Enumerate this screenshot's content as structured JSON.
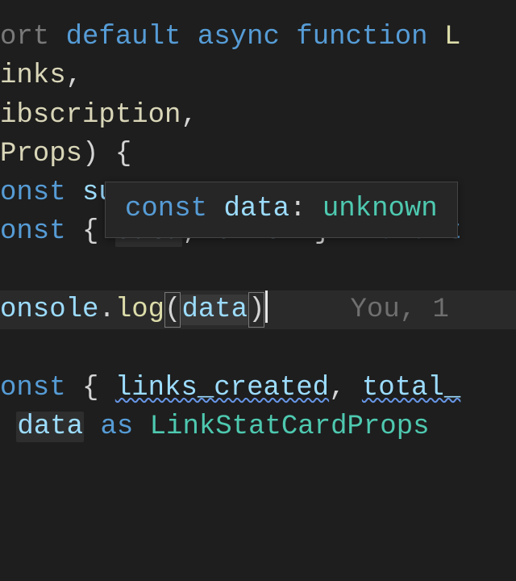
{
  "code": {
    "l1": {
      "pre": "ort ",
      "kw_default": "default",
      "sp1": " ",
      "kw_async": "async",
      "sp2": " ",
      "kw_function": "function",
      "sp3": " ",
      "fn": "L"
    },
    "l2": {
      "pre": "",
      "id": "inks",
      "comma": ","
    },
    "l3": {
      "pre": "",
      "id": "ibscription",
      "comma": ","
    },
    "l4": {
      "pre": "",
      "id": "Props",
      "paren": ")",
      "sp": " ",
      "brace": "{"
    },
    "l5": {
      "pre": "",
      "kw": "onst",
      "sp": " ",
      "id": "su"
    },
    "l6": {
      "pre": "",
      "kw": "onst",
      "sp1": " ",
      "lb": "{",
      "sp2": " ",
      "v1": "data",
      "comma": ",",
      "sp3": " ",
      "v2": "error",
      "sp4": " ",
      "rb": "}",
      "sp5": " ",
      "eq": "=",
      "sp6": " ",
      "aw": "await"
    },
    "l7": {
      "pre": "",
      "obj": "onsole",
      "dot": ".",
      "fn": "log",
      "lp": "(",
      "arg": "data",
      "rp": ")"
    },
    "l8": {
      "pre": "",
      "kw": "onst",
      "sp1": " ",
      "lb": "{",
      "sp2": " ",
      "v1": "links_created",
      "comma": ",",
      "sp3": " ",
      "v2": "total_"
    },
    "l9": {
      "pre": " ",
      "id": "data",
      "sp1": " ",
      "as": "as",
      "sp2": " ",
      "type": "LinkStatCardProps"
    }
  },
  "tooltip": {
    "kw": "const",
    "sp": " ",
    "var": "data",
    "colon": ": ",
    "type": "unknown"
  },
  "codelens": {
    "text": "You, 1"
  }
}
